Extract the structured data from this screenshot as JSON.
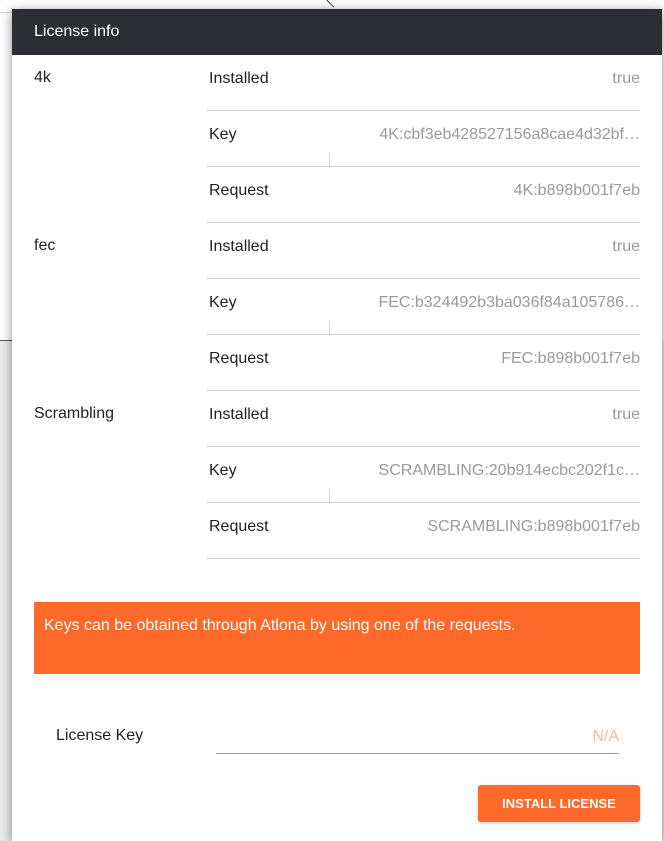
{
  "dialog": {
    "title": "License info"
  },
  "features": [
    {
      "name": "4k",
      "installed_label": "Installed",
      "installed_value": "true",
      "key_label": "Key",
      "key_value": "4K:cbf3eb428527156a8cae4d32bf…",
      "request_label": "Request",
      "request_value": "4K:b898b001f7eb"
    },
    {
      "name": "fec",
      "installed_label": "Installed",
      "installed_value": "true",
      "key_label": "Key",
      "key_value": "FEC:b324492b3ba036f84a105786…",
      "request_label": "Request",
      "request_value": "FEC:b898b001f7eb"
    },
    {
      "name": "Scrambling",
      "installed_label": "Installed",
      "installed_value": "true",
      "key_label": "Key",
      "key_value": "SCRAMBLING:20b914ecbc202f1c…",
      "request_label": "Request",
      "request_value": "SCRAMBLING:b898b001f7eb"
    }
  ],
  "notice": {
    "text": "Keys can be obtained through Atlona by using one of the requests."
  },
  "license_key": {
    "label": "License Key",
    "placeholder": "N/A"
  },
  "install_button": {
    "label": "INSTALL LICENSE"
  },
  "colors": {
    "header": "#2b2e33",
    "accent": "#ff6a2b",
    "muted_text": "#9a9a9a"
  }
}
